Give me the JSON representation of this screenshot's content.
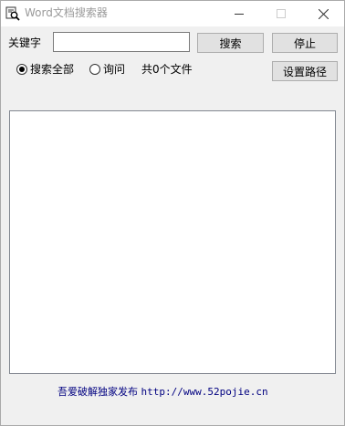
{
  "window": {
    "title": "Word文档搜索器",
    "minimize_icon": "minimize-icon",
    "maximize_icon": "maximize-icon",
    "close_icon": "close-icon"
  },
  "search": {
    "keyword_label": "关键字",
    "keyword_value": "",
    "search_button": "搜索",
    "stop_button": "停止"
  },
  "options": {
    "radio_all_label": "搜索全部",
    "radio_all_selected": true,
    "radio_query_label": "询问",
    "radio_query_selected": false,
    "file_count": "共0个文件",
    "set_path_button": "设置路径"
  },
  "results": {
    "items": []
  },
  "footer": {
    "text": "吾爱破解独家发布",
    "url": "http://www.52pojie.cn"
  },
  "colors": {
    "title_text": "#9a9a9a",
    "footer_text": "#000080",
    "button_bg": "#e1e1e1",
    "window_bg": "#f0f0f0"
  }
}
